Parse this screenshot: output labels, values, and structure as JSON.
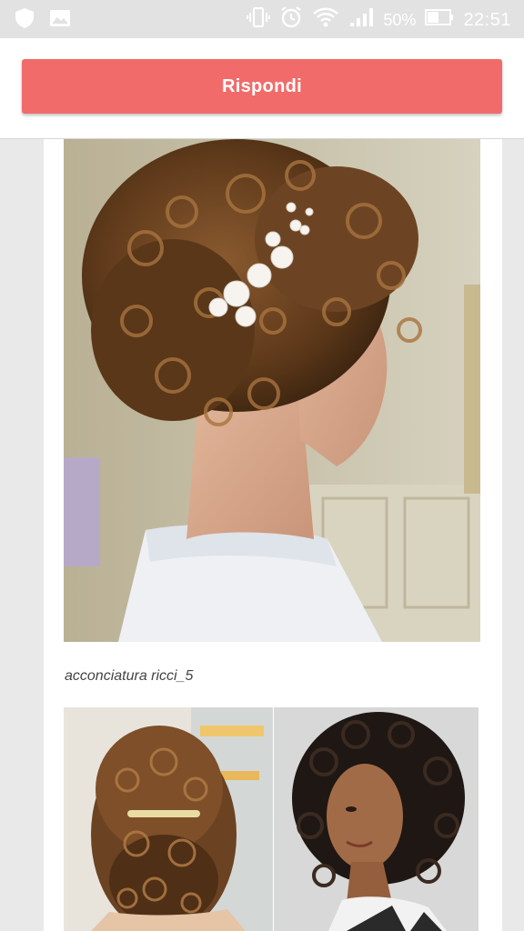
{
  "status_bar": {
    "icons_left": [
      "shield-icon",
      "image-icon"
    ],
    "icons_right": [
      "vibrate-icon",
      "alarm-icon",
      "wifi-icon",
      "signal-icon"
    ],
    "battery_percent": "50%",
    "time": "22:51"
  },
  "header": {
    "reply_label": "Rispondi",
    "accent_color": "#f16b6b"
  },
  "post": {
    "caption": "acconciatura ricci_5"
  }
}
